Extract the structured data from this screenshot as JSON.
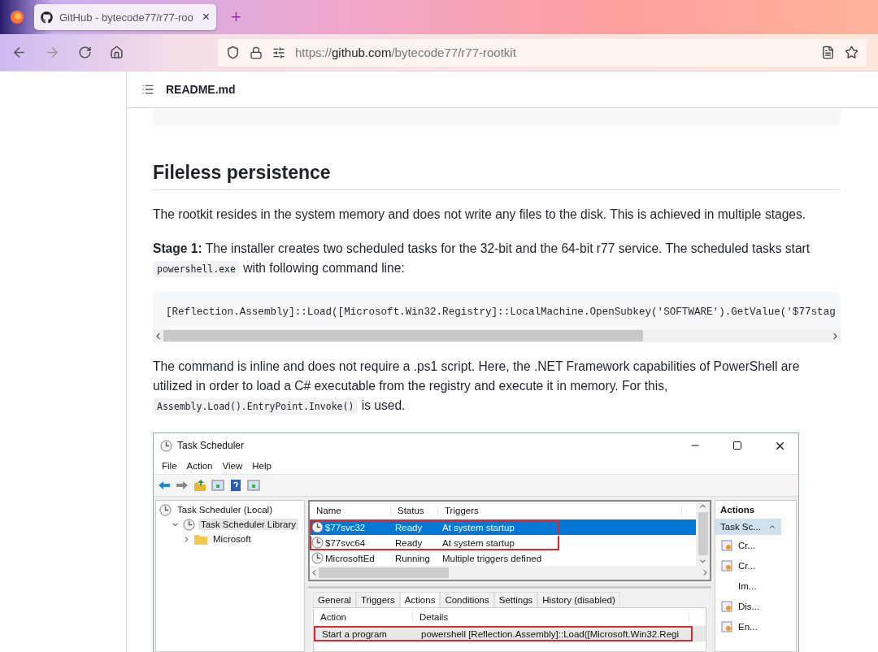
{
  "browser": {
    "tab_title": "GitHub - bytecode77/r77-roo",
    "tab_close": "×",
    "new_tab": "+",
    "url": "https://**github.com**/bytecode77/r77-rootkit"
  },
  "readme": {
    "file_name": "README.md"
  },
  "article": {
    "heading": "Fileless persistence",
    "intro": "The rootkit resides in the system memory and does not write any files to the disk. This is achieved in multiple stages.",
    "stage_paragraph": [
      {
        "kind": "text",
        "text": "**Stage 1:** The installer creates two scheduled tasks for the 32-bit and the 64-bit r77 service. The scheduled tasks start "
      },
      {
        "kind": "code",
        "text": "powershell.exe"
      },
      {
        "kind": "text",
        "text": " with following command line:"
      }
    ],
    "code_block": {
      "text": "[Reflection.Assembly]::Load([Microsoft.Win32.Registry]::LocalMachine.OpenSubkey('SOFTWARE').GetValue('$77stag"
    },
    "explain_paragraph": [
      {
        "kind": "text",
        "text": "The command is inline and does not require a .ps1 script. Here, the .NET Framework capabilities of PowerShell are utilized in order to load a C# executable from the registry and execute it in memory. For this, "
      },
      {
        "kind": "code",
        "text": "Assembly.Load().EntryPoint.Invoke()"
      },
      {
        "kind": "text",
        "text": " is used."
      }
    ]
  },
  "task_scheduler": {
    "title": "Task Scheduler",
    "menu": [
      "File",
      "Action",
      "View",
      "Help"
    ],
    "tree": [
      {
        "label": "Task Scheduler (Local)",
        "selected": false,
        "children": [
          {
            "label": "Task Scheduler Library",
            "expanded": true,
            "selected": true,
            "children": [
              {
                "label": "Microsoft",
                "expanded": false,
                "selected": false
              }
            ]
          }
        ]
      }
    ],
    "task_list": {
      "columns": [
        "Name",
        "Status",
        "Triggers"
      ],
      "rows": [
        {
          "name": "$77svc32",
          "status": "Ready",
          "triggers": "At system startup",
          "selected": true,
          "highlighted": true
        },
        {
          "name": "$77svc64",
          "status": "Ready",
          "triggers": "At system startup",
          "selected": false,
          "highlighted": true
        },
        {
          "name": "MicrosoftEd",
          "status": "Running",
          "triggers": "Multiple triggers defined",
          "selected": false,
          "highlighted": false
        }
      ]
    },
    "tabs": [
      {
        "label": "General",
        "selected": false
      },
      {
        "label": "Triggers",
        "selected": false
      },
      {
        "label": "Actions",
        "selected": true
      },
      {
        "label": "Conditions",
        "selected": false
      },
      {
        "label": "Settings",
        "selected": false
      },
      {
        "label": "History (disabled)",
        "selected": false
      }
    ],
    "actions_list": {
      "columns": [
        "Action",
        "Details"
      ],
      "rows": [
        {
          "action": "Start a program",
          "details": "powershell [Reflection.Assembly]::Load([Microsoft.Win32.Regi",
          "highlighted": true
        }
      ]
    },
    "actions_pane": {
      "title": "Actions",
      "section": "Task Sc...",
      "items": [
        {
          "label": "Cr...",
          "kind": "icon"
        },
        {
          "label": "Cr...",
          "kind": "icon"
        },
        {
          "label": "Im...",
          "kind": "plain"
        },
        {
          "label": "Dis...",
          "kind": "icon"
        },
        {
          "label": "En...",
          "kind": "icon"
        }
      ]
    }
  }
}
